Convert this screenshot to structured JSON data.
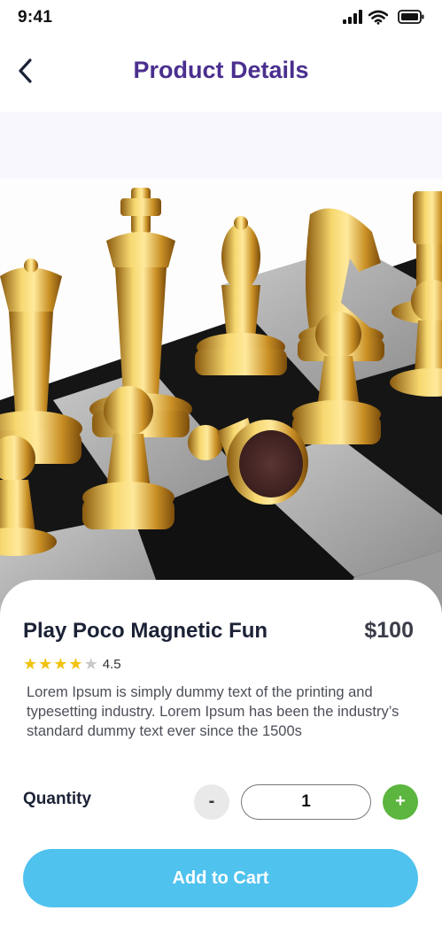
{
  "status_bar": {
    "time": "9:41",
    "icons": [
      "signal-icon",
      "wifi-icon",
      "battery-icon"
    ]
  },
  "header": {
    "title": "Product Details",
    "back_icon": "chevron-left-icon"
  },
  "product": {
    "name": "Play Poco Magnetic Fun",
    "price": "$100",
    "rating": 4.5,
    "rating_text": "4.5",
    "stars_filled": 4,
    "stars_total": 5,
    "description": "Lorem Ipsum is simply dummy text of the printing and typesetting industry. Lorem Ipsum has been the industry’s standard dummy text ever since the 1500s"
  },
  "quantity": {
    "label": "Quantity",
    "decrement_label": "-",
    "value": "1",
    "increment_label": "+"
  },
  "cart": {
    "button_label": "Add to Cart"
  },
  "colors": {
    "title": "#4a2f8f",
    "star": "#f0c30f",
    "increment": "#5bb53e",
    "cart_button": "#4fc2ee"
  }
}
